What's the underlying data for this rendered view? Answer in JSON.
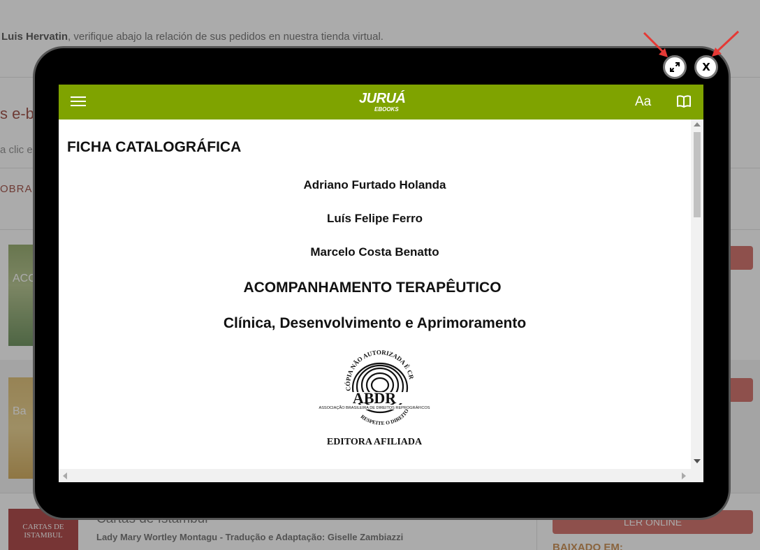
{
  "background": {
    "greeting_name": "Luis Hervatin",
    "greeting_text": ", verifique abajo la relación de sus pedidos en nuestra tienda virtual.",
    "section_title_fragment": "s e-b",
    "hint_fragment": "a clic en",
    "column_header_fragment": "OBRA",
    "covers": [
      {
        "text": "ACOM TE"
      },
      {
        "text": "Ba"
      },
      {
        "text": "CARTAS DE ISTAMBUL"
      }
    ],
    "third_book": {
      "title": "Cartas de Istambul",
      "author": "Lady Mary Wortley Montagu - Tradução e Adaptação: Giselle Zambiazzi",
      "read_online_label": "LER ONLINE",
      "downloaded_label": "BAIXADO EM:"
    }
  },
  "modal": {
    "expand_icon": "expand-icon",
    "close_label": "X"
  },
  "reader": {
    "logo_main": "JURUÁ",
    "logo_sub": "EBOOKS",
    "font_button_label": "Aa",
    "bar_color": "#7fa300"
  },
  "document": {
    "heading": "FICHA CATALOGRÁFICA",
    "authors": [
      "Adriano Furtado Holanda",
      "Luís Felipe Ferro",
      "Marcelo Costa Benatto"
    ],
    "title": "ACOMPANHAMENTO TERAPÊUTICO",
    "subtitle": "Clínica, Desenvolvimento e Aprimoramento",
    "seal": {
      "arc_text": "CÓPIA NÃO AUTORIZADA É CRIME",
      "acronym": "ABDR",
      "org_name": "ASSOCIAÇÃO BRASILEIRA DE DIREITOS REPROGRÁFICOS",
      "bottom_arc": "RESPEITE O DIREITO AUTORAL",
      "affiliate": "EDITORA AFILIADA"
    }
  }
}
